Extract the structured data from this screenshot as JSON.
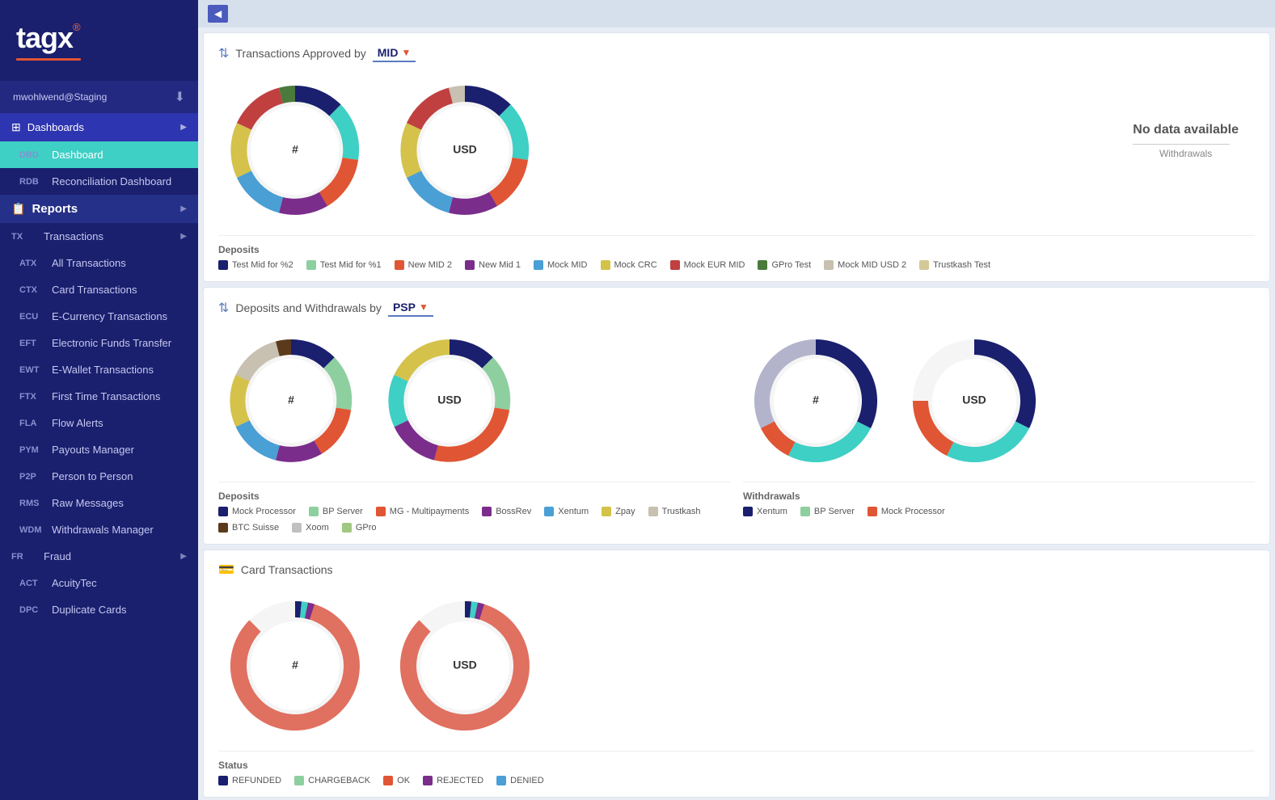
{
  "app": {
    "logo": "tagx",
    "logo_reg": "®"
  },
  "user": {
    "name": "mwohlwend@Staging"
  },
  "sidebar": {
    "sections": [
      {
        "id": "dashboards",
        "code": "grid",
        "label": "Dashboards",
        "active_section": true,
        "has_arrow": true
      },
      {
        "id": "dbd",
        "code": "DBD",
        "label": "Dashboard",
        "active_item": true
      },
      {
        "id": "rdb",
        "code": "RDB",
        "label": "Reconciliation Dashboard"
      },
      {
        "id": "reports",
        "code": "report",
        "label": "Reports",
        "has_arrow": true
      },
      {
        "id": "tx",
        "code": "TX",
        "label": "Transactions",
        "has_arrow": true
      },
      {
        "id": "atx",
        "code": "ATX",
        "label": "All Transactions"
      },
      {
        "id": "ctx",
        "code": "CTX",
        "label": "Card Transactions"
      },
      {
        "id": "ecu",
        "code": "ECU",
        "label": "E-Currency Transactions"
      },
      {
        "id": "eft",
        "code": "EFT",
        "label": "Electronic Funds Transfer"
      },
      {
        "id": "ewt",
        "code": "EWT",
        "label": "E-Wallet Transactions"
      },
      {
        "id": "ftx",
        "code": "FTX",
        "label": "First Time Transactions"
      },
      {
        "id": "fla",
        "code": "FLA",
        "label": "Flow Alerts"
      },
      {
        "id": "pym",
        "code": "PYM",
        "label": "Payouts Manager"
      },
      {
        "id": "p2p",
        "code": "P2P",
        "label": "Person to Person"
      },
      {
        "id": "rms",
        "code": "RMS",
        "label": "Raw Messages"
      },
      {
        "id": "wdm",
        "code": "WDM",
        "label": "Withdrawals Manager"
      },
      {
        "id": "fr",
        "code": "FR",
        "label": "Fraud",
        "has_arrow": true
      },
      {
        "id": "act",
        "code": "ACT",
        "label": "AcuityTec"
      },
      {
        "id": "dpc",
        "code": "DPC",
        "label": "Duplicate Cards"
      }
    ]
  },
  "topbar": {
    "collapse_label": "◀"
  },
  "section1": {
    "title": "Transactions Approved by",
    "dropdown": "MID",
    "chart1_center": "#",
    "chart2_center": "USD",
    "no_data_text": "No data available",
    "no_data_sub": "Withdrawals",
    "deposits_title": "Deposits",
    "legend": [
      {
        "label": "Test Mid for %2",
        "color": "#1a1f6e"
      },
      {
        "label": "Test Mid for %1",
        "color": "#8ecfa0"
      },
      {
        "label": "New MID 2",
        "color": "#e05533"
      },
      {
        "label": "New Mid 1",
        "color": "#7b2d8b"
      },
      {
        "label": "Mock MID",
        "color": "#4a9fd4"
      },
      {
        "label": "Mock CRC",
        "color": "#d4c24a"
      },
      {
        "label": "Mock EUR MID",
        "color": "#c04040"
      },
      {
        "label": "GPro Test",
        "color": "#4a7a3c"
      },
      {
        "label": "Mock MID USD 2",
        "color": "#c8c0b0"
      },
      {
        "label": "Trustkash Test",
        "color": "#d4c896"
      }
    ]
  },
  "section2": {
    "title": "Deposits and Withdrawals by",
    "dropdown": "PSP",
    "chart1_center": "#",
    "chart2_center": "USD",
    "chart3_center": "#",
    "chart4_center": "USD",
    "deposits_title": "Deposits",
    "withdrawals_title": "Withdrawals",
    "deposits_legend": [
      {
        "label": "Mock Processor",
        "color": "#1a1f6e"
      },
      {
        "label": "BP Server",
        "color": "#8ecfa0"
      },
      {
        "label": "MG - Multipayments",
        "color": "#e05533"
      },
      {
        "label": "BossRev",
        "color": "#7b2d8b"
      },
      {
        "label": "Xentum",
        "color": "#4a9fd4"
      },
      {
        "label": "Zpay",
        "color": "#d4c24a"
      },
      {
        "label": "Trustkash",
        "color": "#c8c0b0"
      },
      {
        "label": "BTC Suisse",
        "color": "#5a3a1a"
      },
      {
        "label": "Xoom",
        "color": "#c0c0c0"
      },
      {
        "label": "GPro",
        "color": "#a0c880"
      }
    ],
    "withdrawals_legend": [
      {
        "label": "Xentum",
        "color": "#1a1f6e"
      },
      {
        "label": "BP Server",
        "color": "#8ecfa0"
      },
      {
        "label": "Mock Processor",
        "color": "#e05533"
      }
    ]
  },
  "section3": {
    "title": "Card Transactions",
    "chart1_center": "#",
    "chart2_center": "USD",
    "status_title": "Status",
    "status_legend": [
      {
        "label": "REFUNDED",
        "color": "#1a1f6e"
      },
      {
        "label": "CHARGEBACK",
        "color": "#8ecfa0"
      },
      {
        "label": "OK",
        "color": "#e05533"
      },
      {
        "label": "REJECTED",
        "color": "#7b2d8b"
      },
      {
        "label": "DENIED",
        "color": "#4a9fd4"
      }
    ]
  }
}
